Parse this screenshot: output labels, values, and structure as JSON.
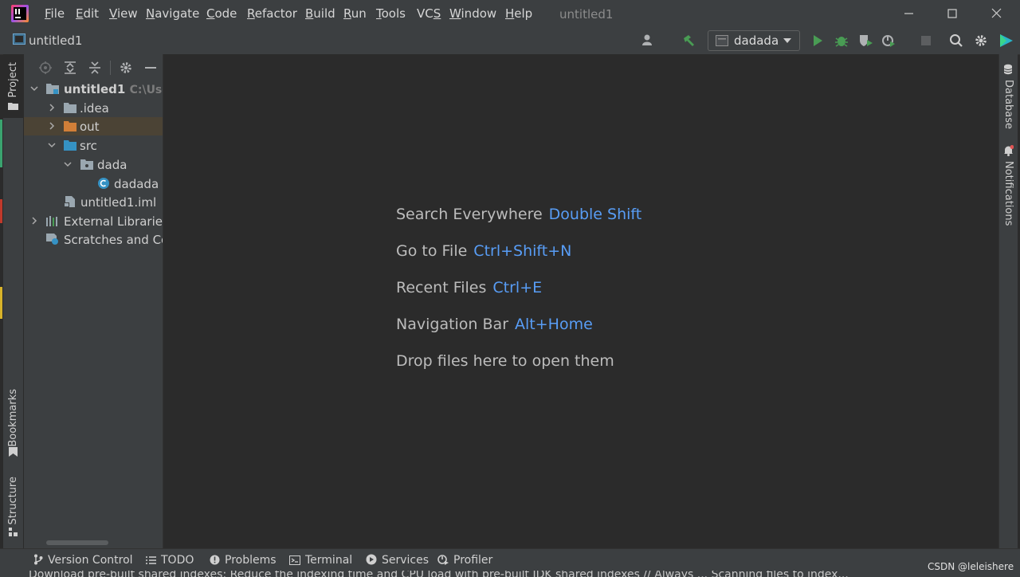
{
  "menu": [
    "File",
    "Edit",
    "View",
    "Navigate",
    "Code",
    "Refactor",
    "Build",
    "Run",
    "Tools",
    "VCS",
    "Window",
    "Help"
  ],
  "menu_mnemonic": [
    "F",
    "E",
    "V",
    "N",
    "C",
    "R",
    "B",
    "R",
    "T",
    "S",
    "W",
    "H"
  ],
  "window_title": "untitled1",
  "nav": {
    "project_name": "untitled1",
    "run_config": "dadada"
  },
  "left_tabs": {
    "project": "Project",
    "bookmarks": "Bookmarks",
    "structure": "Structure"
  },
  "right_tabs": {
    "database": "Database",
    "notifications": "Notifications"
  },
  "tree": {
    "root": "untitled1",
    "root_path": "C:\\Users",
    "idea": ".idea",
    "out": "out",
    "src": "src",
    "dada": "dada",
    "dadada": "dadada",
    "iml": "untitled1.iml",
    "ext_libs": "External Libraries",
    "scratches": "Scratches and Con"
  },
  "hints": [
    {
      "label": "Search Everywhere",
      "key": "Double Shift"
    },
    {
      "label": "Go to File",
      "key": "Ctrl+Shift+N"
    },
    {
      "label": "Recent Files",
      "key": "Ctrl+E"
    },
    {
      "label": "Navigation Bar",
      "key": "Alt+Home"
    },
    {
      "label": "Drop files here to open them",
      "key": ""
    }
  ],
  "bottom_tabs": {
    "vcs": "Version Control",
    "todo": "TODO",
    "problems": "Problems",
    "terminal": "Terminal",
    "services": "Services",
    "profiler": "Profiler"
  },
  "status": "Download pre-built shared indexes: Reduce the indexing time and CPU load with pre-built JDK shared indexes // Always ...   Scanning files to index...",
  "watermark": "CSDN @leleishere",
  "colors": {
    "accent_key": "#589df6",
    "run_green": "#499c54",
    "out_folder": "#d27f38",
    "src_folder": "#3592c4",
    "selected_row": "#4b4335"
  }
}
